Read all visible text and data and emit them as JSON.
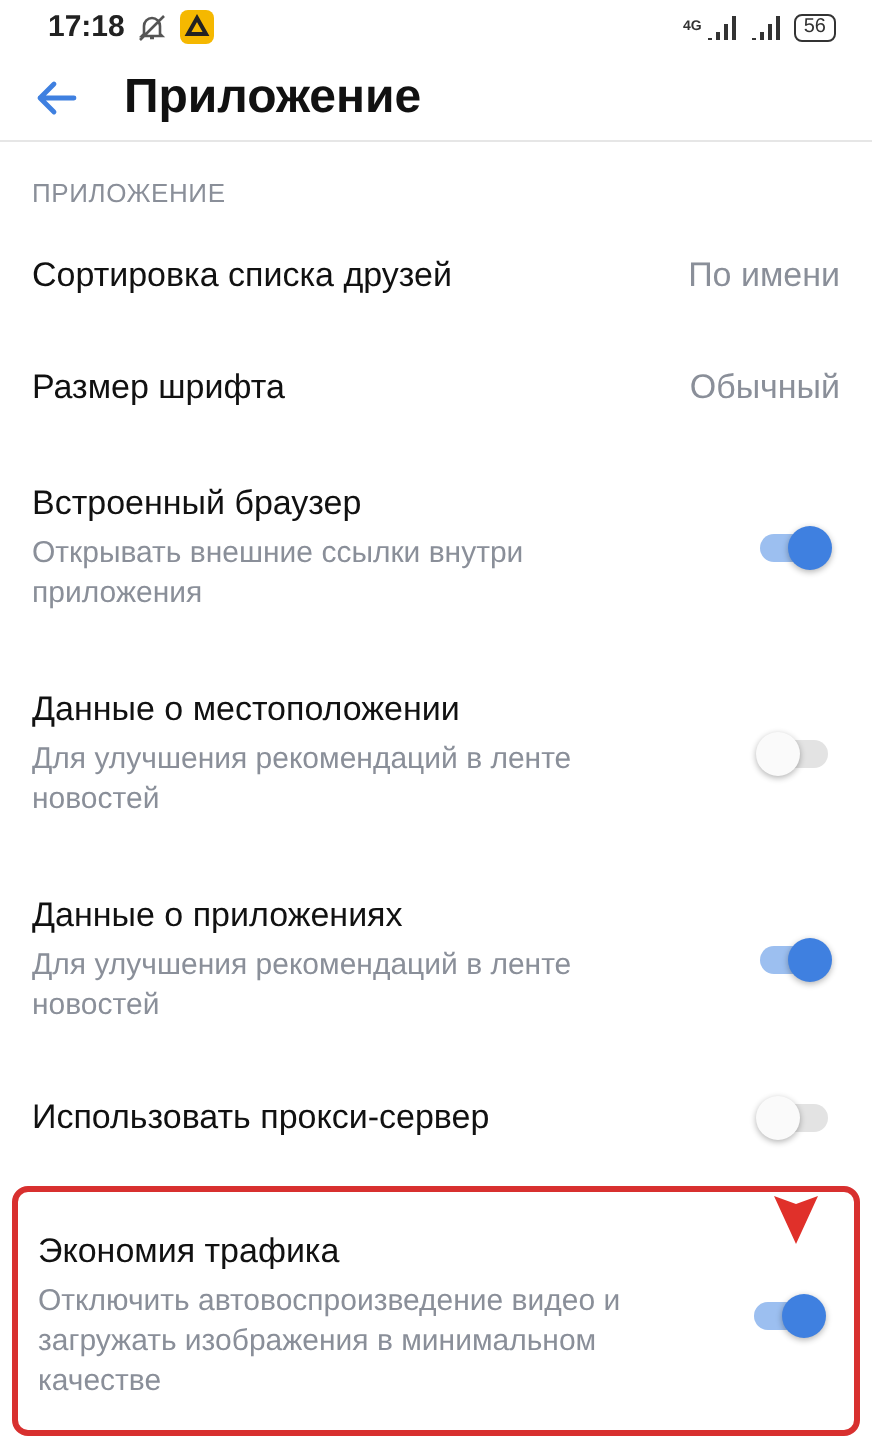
{
  "status_bar": {
    "time": "17:18",
    "network": "4G",
    "battery": "56"
  },
  "header": {
    "title": "Приложение"
  },
  "section": {
    "title": "ПРИЛОЖЕНИЕ"
  },
  "settings": [
    {
      "kind": "value",
      "title": "Сортировка списка друзей",
      "value": "По имени",
      "highlighted": false
    },
    {
      "kind": "value",
      "title": "Размер шрифта",
      "value": "Обычный",
      "highlighted": false
    },
    {
      "kind": "toggle",
      "title": "Встроенный браузер",
      "subtitle": "Открывать внешние ссылки внутри приложения",
      "on": true,
      "highlighted": false
    },
    {
      "kind": "toggle",
      "title": "Данные о местоположении",
      "subtitle": "Для улучшения рекомендаций в ленте новостей",
      "on": false,
      "highlighted": false
    },
    {
      "kind": "toggle",
      "title": "Данные о приложениях",
      "subtitle": "Для улучшения рекомендаций в ленте новостей",
      "on": true,
      "highlighted": false
    },
    {
      "kind": "toggle",
      "title": "Использовать прокси-сервер",
      "on": false,
      "highlighted": false
    },
    {
      "kind": "toggle",
      "title": "Экономия трафика",
      "subtitle": "Отключить автовоспроизведение видео и загружать изображения в минимальном качестве",
      "on": true,
      "highlighted": true
    }
  ]
}
